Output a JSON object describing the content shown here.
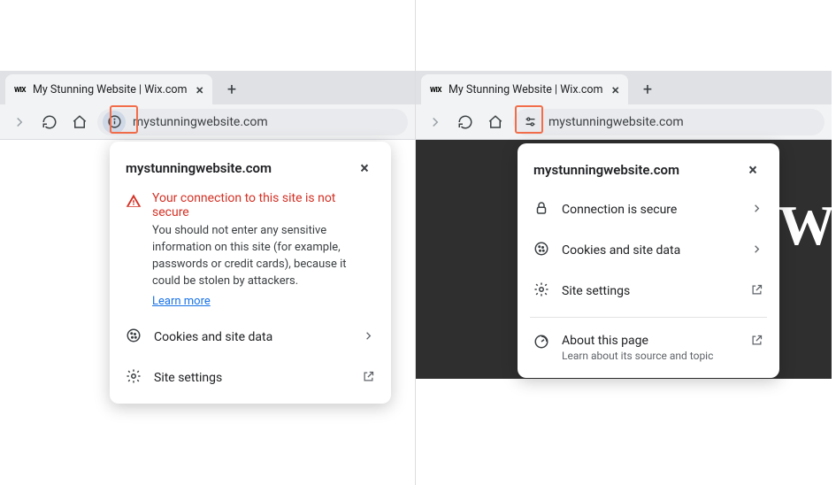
{
  "left": {
    "tab_title": "My Stunning Website | Wix.com",
    "url": "mystunningwebsite.com",
    "popover": {
      "domain": "mystunningwebsite.com",
      "warning_title": "Your connection to this site is not secure",
      "warning_body": "You should not enter any sensitive information on this site (for example, passwords or credit cards), because it could be stolen by attackers.",
      "learn_more": "Learn more",
      "cookies": "Cookies and site data",
      "site_settings": "Site settings"
    }
  },
  "right": {
    "tab_title": "My Stunning Website | Wix.com",
    "url": "mystunningwebsite.com",
    "popover": {
      "domain": "mystunningwebsite.com",
      "connection": "Connection is secure",
      "cookies": "Cookies and site data",
      "site_settings": "Site settings",
      "about": "About this page",
      "about_sub": "Learn about its source and topic"
    }
  }
}
